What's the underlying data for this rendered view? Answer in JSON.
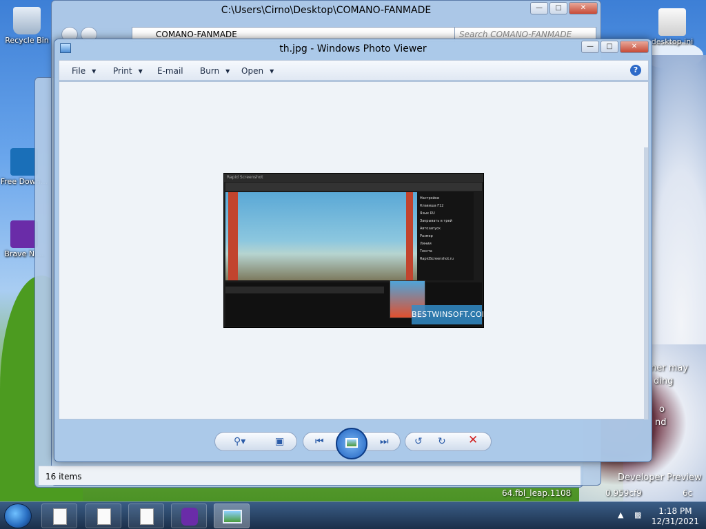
{
  "desktop": {
    "icons": [
      {
        "label": "Recycle Bin"
      },
      {
        "label": "Free Down..."
      },
      {
        "label": "Brave Ni..."
      },
      {
        "label": "desktop.ini"
      }
    ],
    "bg_text": [
      "ner may",
      "ding",
      "o",
      "nd",
      "Developer Preview",
      "64.fbl_leap.1108",
      "0.959cf9",
      "6c"
    ]
  },
  "explorer": {
    "title": "C:\\Users\\Cirno\\Desktop\\COMANO-FANMADE",
    "address": "COMANO-FANMADE",
    "search_placeholder": "Search COMANO-FANMADE",
    "status_items": "16 items"
  },
  "viewer": {
    "title": "th.jpg - Windows Photo Viewer",
    "menu": [
      "File",
      "Print",
      "E-mail",
      "Burn",
      "Open"
    ],
    "help_label": "?",
    "image": {
      "app_title": "Rapid Screenshot",
      "panel_lines": [
        "Настройки",
        "Клавиша F12",
        "Язык  RU",
        "Закрывать в трей",
        "Автозапуск",
        "Размер",
        "Линии",
        "Текста",
        "RapidScreenshot.ru"
      ],
      "watermark": "BESTWINSOFT.COM"
    }
  },
  "taskbar": {
    "time": "1:18 PM",
    "date": "12/31/2021"
  },
  "icons": {
    "zoom": "magnifier-icon",
    "fit": "actual-size-icon",
    "prev": "previous-icon",
    "slideshow": "slideshow-icon",
    "next": "next-icon",
    "rotate_ccw": "rotate-ccw-icon",
    "rotate_cw": "rotate-cw-icon",
    "delete": "delete-icon"
  }
}
